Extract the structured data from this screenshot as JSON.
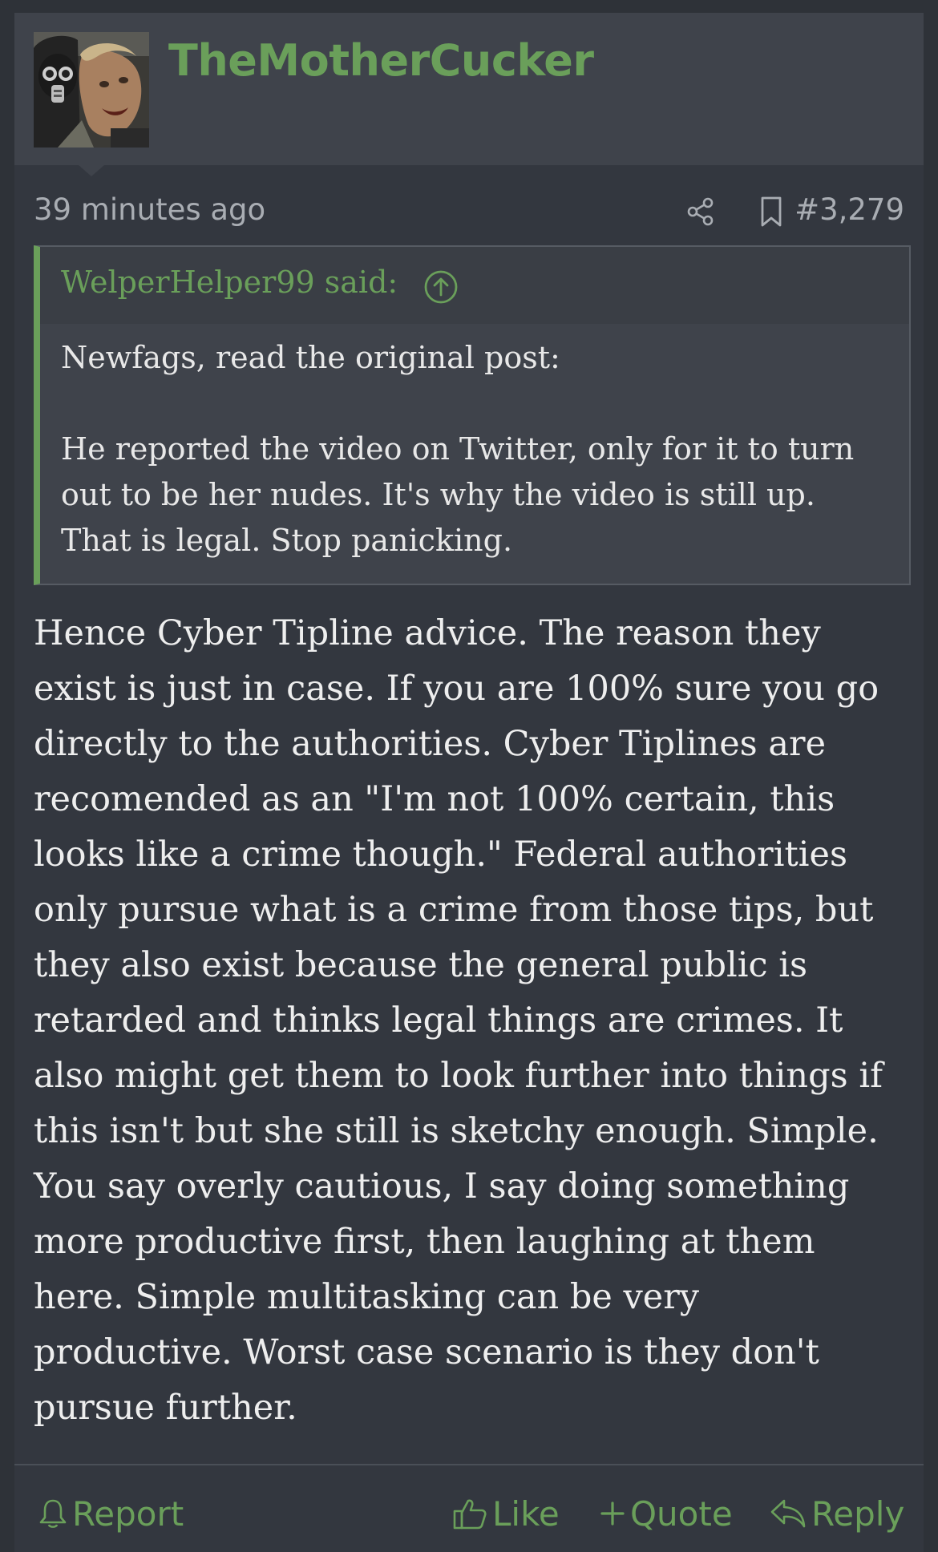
{
  "post": {
    "username": "TheMotherCucker",
    "timestamp": "39 minutes ago",
    "post_number": "#3,279",
    "quote": {
      "author": "WelperHelper99 said:",
      "paragraphs": [
        "Newfags, read the original post:",
        "He reported the video on Twitter, only for it to turn out to be her nudes. It's why the video is still up. That is legal. Stop panicking."
      ]
    },
    "message": "Hence Cyber Tipline advice. The reason they exist is just in case. If you are 100% sure you go directly to the authorities. Cyber Tiplines are recomended as an \"I'm not 100% certain, this looks like a crime though.\" Federal authorities only pursue what is a crime from those tips, but they also exist because the general public is retarded and thinks legal things are crimes. It also might get them to look further into things if this isn't but she still is sketchy enough. Simple. You say overly cautious, I say doing something more productive first, then laughing at them here. Simple multitasking can be very productive. Worst case scenario is they don't pursue further.",
    "actions": {
      "report": "Report",
      "like": "Like",
      "quote": "Quote",
      "reply": "Reply"
    }
  },
  "icons": {
    "share": "share-icon",
    "bookmark": "bookmark-icon",
    "jump_to_quote": "arrow-up-circle-icon",
    "report": "bell-icon",
    "like": "thumbs-up-icon",
    "quote": "plus-icon",
    "reply": "reply-arrow-icon"
  },
  "colors": {
    "accent": "#6a9f5a",
    "background": "#2e3238",
    "post_background": "#33373f",
    "header_background": "#3f434b",
    "text": "#eeeeee",
    "muted_text": "#a9adb3"
  }
}
